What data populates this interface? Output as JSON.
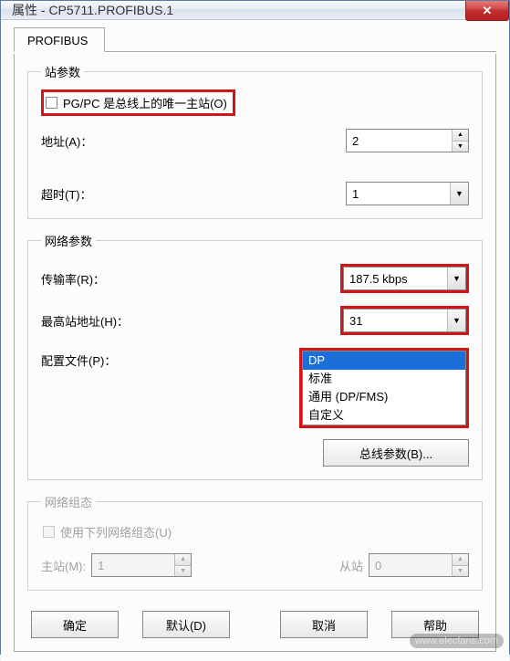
{
  "window": {
    "title": "属性 - CP5711.PROFIBUS.1",
    "close_icon": "✕"
  },
  "tabs": {
    "profibus": "PROFIBUS"
  },
  "station": {
    "legend": "站参数",
    "only_master_label": "PG/PC 是总线上的唯一主站(O)",
    "only_master_checked": false,
    "address_label": "地址(A)：",
    "address_value": "2",
    "timeout_label": "超时(T)：",
    "timeout_value": "1"
  },
  "network": {
    "legend": "网络参数",
    "rate_label": "传输率(R)：",
    "rate_value": "187.5 kbps",
    "max_addr_label": "最高站地址(H)：",
    "max_addr_value": "31",
    "profile_label": "配置文件(P)：",
    "profile_options": {
      "dp": "DP",
      "standard": "标准",
      "universal": "通用 (DP/FMS)",
      "custom": "自定义"
    },
    "profile_selected": "DP",
    "bus_params_button": "总线参数(B)..."
  },
  "netconfig": {
    "legend": "网络组态",
    "use_label": "使用下列网络组态(U)",
    "master_label": "主站(M):",
    "master_value": "1",
    "slave_label": "从站",
    "slave_value": "0"
  },
  "buttons": {
    "ok": "确定",
    "default": "默认(D)",
    "cancel": "取消",
    "help": "帮助"
  },
  "watermark": "www.elecfans.com"
}
